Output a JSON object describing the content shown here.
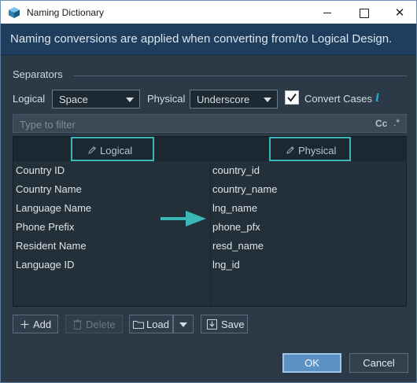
{
  "window": {
    "title": "Naming Dictionary",
    "close_glyph": "✕"
  },
  "banner": {
    "text": "Naming conversions are applied when converting from/to Logical Design."
  },
  "separators": {
    "section_label": "Separators",
    "logical_label": "Logical",
    "logical_value": "Space",
    "physical_label": "Physical",
    "physical_value": "Underscore",
    "convert_cases_label": "Convert Cases",
    "convert_cases_checked": true,
    "info_glyph": "i"
  },
  "filter": {
    "placeholder": "Type to filter",
    "case_toggle": "Cc",
    "regex_toggle": ".*"
  },
  "table": {
    "headers": {
      "logical": "Logical",
      "physical": "Physical"
    },
    "rows": [
      {
        "logical": "Country ID",
        "physical": "country_id"
      },
      {
        "logical": "Country Name",
        "physical": "country_name"
      },
      {
        "logical": "Language Name",
        "physical": "lng_name"
      },
      {
        "logical": "Phone Prefix",
        "physical": "phone_pfx"
      },
      {
        "logical": "Resident Name",
        "physical": "resd_name"
      },
      {
        "logical": "Language ID",
        "physical": "lng_id"
      }
    ]
  },
  "toolbar": {
    "add_label": "Add",
    "delete_label": "Delete",
    "load_label": "Load",
    "save_label": "Save"
  },
  "footer": {
    "ok_label": "OK",
    "cancel_label": "Cancel"
  },
  "colors": {
    "accent_teal": "#3ab7b7",
    "banner_bg": "#1f3d5c",
    "dialog_bg": "#2b3a46",
    "ok_button": "#5b92c4"
  },
  "icons": {
    "app": "database-cube-icon",
    "add": "plus-icon",
    "delete": "trash-icon",
    "load": "folder-icon",
    "save": "save-icon",
    "header_edit": "pencil-icon",
    "annotation": "arrow-right-icon"
  }
}
